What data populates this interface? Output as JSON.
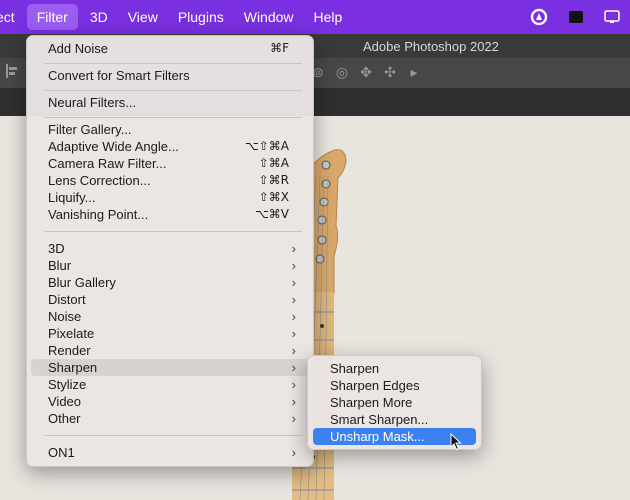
{
  "menubar": {
    "items": [
      "ect",
      "Filter",
      "3D",
      "View",
      "Plugins",
      "Window",
      "Help"
    ],
    "active": "Filter",
    "colors": {
      "bar": "#7a2fe0",
      "active": "#9b5cf0"
    },
    "right_icons": [
      "creative-cloud-icon",
      "screen-record-icon",
      "display-icon"
    ]
  },
  "app": {
    "title": "Adobe Photoshop 2022"
  },
  "filter_menu": {
    "groups": [
      [
        {
          "label": "Add Noise",
          "shortcut": "⌘F"
        }
      ],
      [
        {
          "label": "Convert for Smart Filters",
          "shortcut": ""
        }
      ],
      [
        {
          "label": "Neural Filters...",
          "shortcut": ""
        }
      ],
      [
        {
          "label": "Filter Gallery...",
          "shortcut": ""
        },
        {
          "label": "Adaptive Wide Angle...",
          "shortcut": "⌥⇧⌘A"
        },
        {
          "label": "Camera Raw Filter...",
          "shortcut": "⇧⌘A"
        },
        {
          "label": "Lens Correction...",
          "shortcut": "⇧⌘R"
        },
        {
          "label": "Liquify...",
          "shortcut": "⇧⌘X"
        },
        {
          "label": "Vanishing Point...",
          "shortcut": "⌥⌘V"
        }
      ],
      [
        {
          "label": "3D",
          "submenu": true
        },
        {
          "label": "Blur",
          "submenu": true
        },
        {
          "label": "Blur Gallery",
          "submenu": true
        },
        {
          "label": "Distort",
          "submenu": true
        },
        {
          "label": "Noise",
          "submenu": true
        },
        {
          "label": "Pixelate",
          "submenu": true
        },
        {
          "label": "Render",
          "submenu": true
        },
        {
          "label": "Sharpen",
          "submenu": true,
          "highlighted": true
        },
        {
          "label": "Stylize",
          "submenu": true
        },
        {
          "label": "Video",
          "submenu": true
        },
        {
          "label": "Other",
          "submenu": true
        }
      ],
      [
        {
          "label": "ON1",
          "submenu": true
        }
      ]
    ]
  },
  "sharpen_submenu": {
    "items": [
      "Sharpen",
      "Sharpen Edges",
      "Sharpen More",
      "Smart Sharpen...",
      "Unsharp Mask..."
    ],
    "selected": "Unsharp Mask...",
    "selection_color": "#3b82f0"
  },
  "canvas": {
    "image": "guitar-headstock"
  }
}
